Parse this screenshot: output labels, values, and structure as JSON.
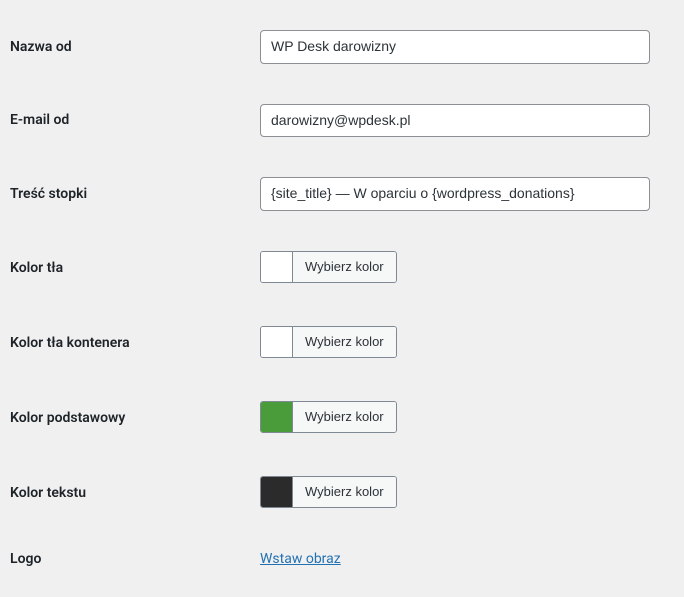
{
  "rows": {
    "name_from": {
      "label": "Nazwa od",
      "value": "WP Desk darowizny"
    },
    "email_from": {
      "label": "E-mail od",
      "value": "darowizny@wpdesk.pl"
    },
    "footer_text": {
      "label": "Treść stopki",
      "value": "{site_title} — W oparciu o {wordpress_donations}"
    },
    "bg_color": {
      "label": "Kolor tła",
      "button": "Wybierz kolor",
      "swatch": "#ffffff"
    },
    "container_bg_color": {
      "label": "Kolor tła kontenera",
      "button": "Wybierz kolor",
      "swatch": "#ffffff"
    },
    "primary_color": {
      "label": "Kolor podstawowy",
      "button": "Wybierz kolor",
      "swatch": "#4a9c3a"
    },
    "text_color": {
      "label": "Kolor tekstu",
      "button": "Wybierz kolor",
      "swatch": "#2b2b2b"
    },
    "logo": {
      "label": "Logo",
      "link": "Wstaw obraz"
    }
  }
}
